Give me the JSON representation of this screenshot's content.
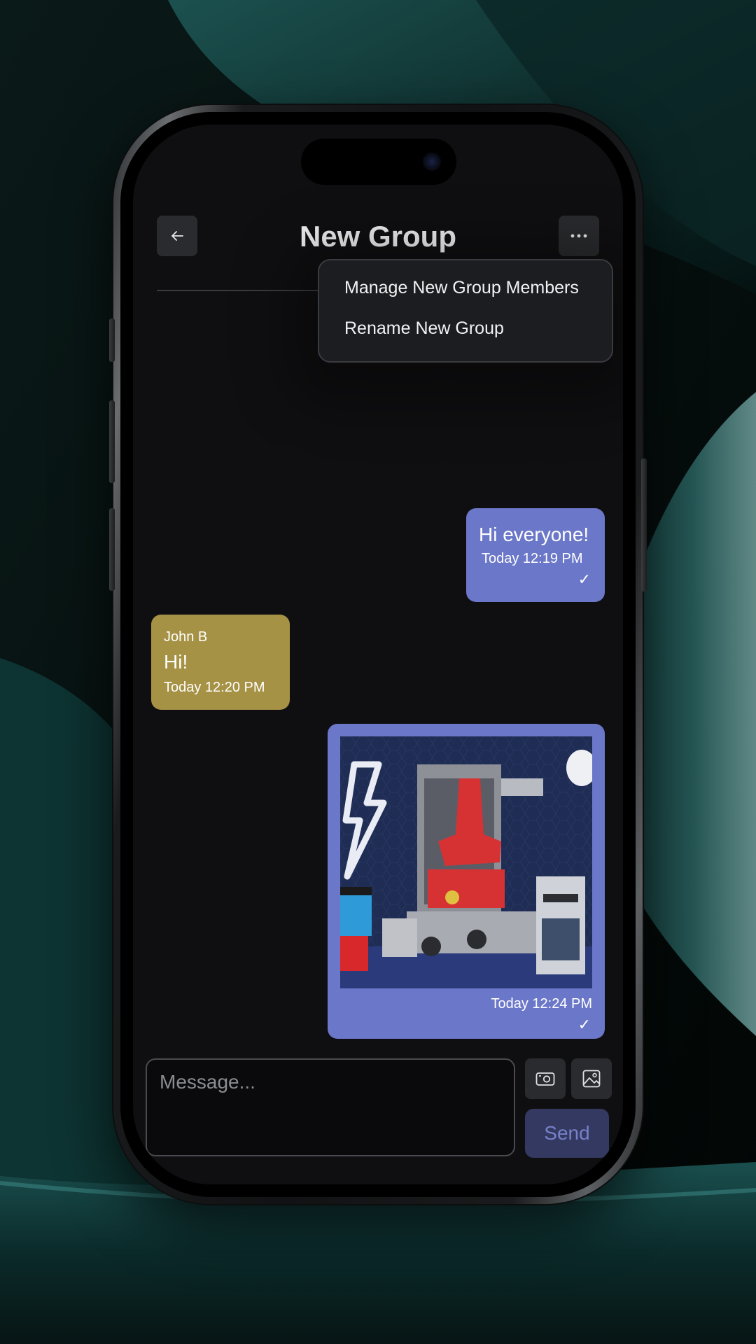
{
  "header": {
    "title": "New Group",
    "back_icon": "arrow-left-icon",
    "more_icon": "ellipsis-icon"
  },
  "menu": {
    "items": [
      {
        "label": "Manage New Group Members"
      },
      {
        "label": "Rename New Group"
      }
    ]
  },
  "messages": [
    {
      "direction": "outgoing",
      "text": "Hi everyone!",
      "time": "Today 12:19 PM",
      "status": "✓"
    },
    {
      "direction": "incoming",
      "sender": "John B",
      "text": "Hi!",
      "time": "Today 12:20 PM"
    },
    {
      "direction": "outgoing",
      "type": "image",
      "image_desc": "robot-photo",
      "time": "Today 12:24 PM",
      "status": "✓"
    }
  ],
  "composer": {
    "placeholder": "Message...",
    "camera_icon": "camera-icon",
    "gallery_icon": "image-icon",
    "send_label": "Send"
  },
  "colors": {
    "outgoing_bubble": "#6b77c8",
    "incoming_bubble": "#a69245",
    "screen_bg": "#0f0f11",
    "send_button_bg": "#343961"
  }
}
